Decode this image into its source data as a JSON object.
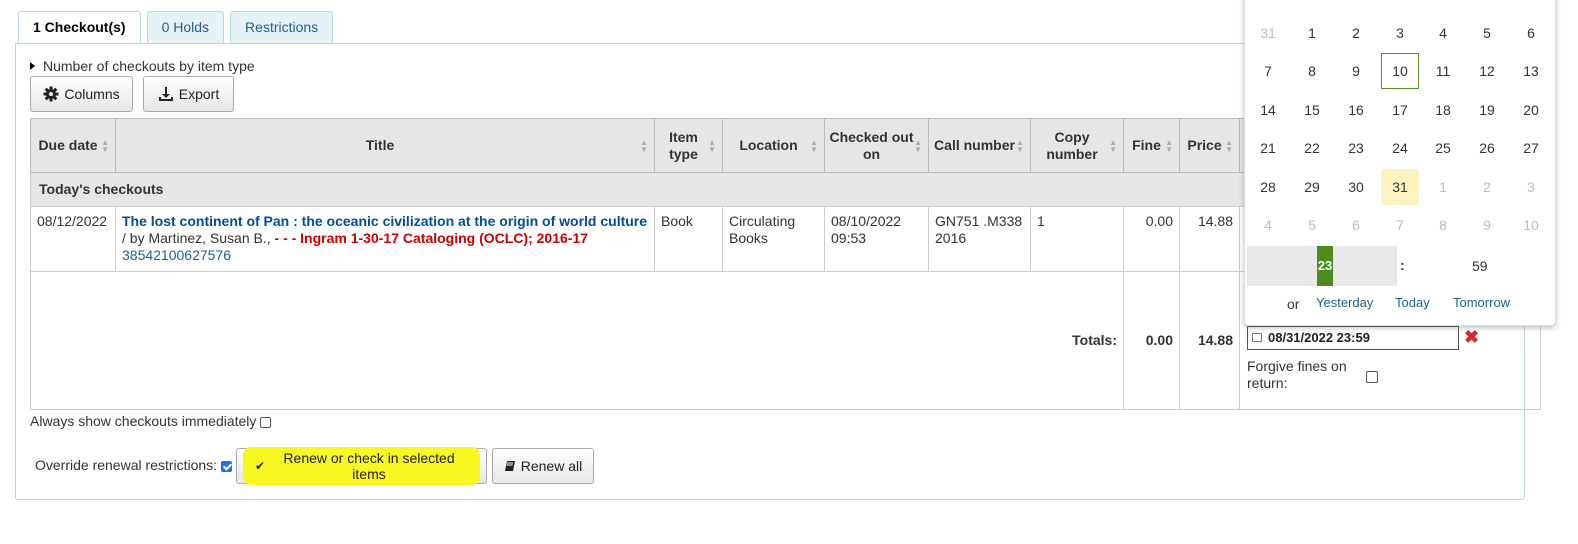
{
  "tabs": [
    {
      "label": "1 Checkout(s)"
    },
    {
      "label": "0 Holds"
    },
    {
      "label": "Restrictions"
    }
  ],
  "summary_toggle": "Number of checkouts by item type",
  "buttons": {
    "columns": "Columns",
    "export": "Export"
  },
  "table": {
    "headers": {
      "due": "Due date",
      "title": "Title",
      "itemtype": "Item type",
      "location": "Location",
      "checkedout": "Checked out on",
      "callnumber": "Call number",
      "copynumber": "Copy number",
      "fine": "Fine",
      "price": "Price"
    },
    "group_label": "Today's checkouts",
    "row": {
      "due": "08/12/2022",
      "title": "The lost continent of Pan : the oceanic civilization at the origin of world culture",
      "author": " / by Martinez, Susan B.,",
      "dashes": " - - - ",
      "cataloging": "Ingram 1-30-17 Cataloging (OCLC); 2016-17",
      "barcode": "38542100627576",
      "itemtype": "Book",
      "location": "Circulating Books",
      "checkedout": "08/10/2022 09:53",
      "callnumber": "GN751 .M338 2016",
      "copynumber": "1",
      "fine": "0.00",
      "price": "14.88"
    },
    "totals": {
      "label": "Totals:",
      "fine": "0.00",
      "price": "14.88"
    }
  },
  "always_show": "Always show checkouts immediately",
  "override": "Override renewal restrictions:",
  "renew_selected": "Renew or check in selected items",
  "renew_all": "Renew all",
  "calendar": {
    "weeks": [
      [
        "31",
        "1",
        "2",
        "3",
        "4",
        "5",
        "6"
      ],
      [
        "7",
        "8",
        "9",
        "10",
        "11",
        "12",
        "13"
      ],
      [
        "14",
        "15",
        "16",
        "17",
        "18",
        "19",
        "20"
      ],
      [
        "21",
        "22",
        "23",
        "24",
        "25",
        "26",
        "27"
      ],
      [
        "28",
        "29",
        "30",
        "31",
        "1",
        "2",
        "3"
      ],
      [
        "4",
        "5",
        "6",
        "7",
        "8",
        "9",
        "10"
      ]
    ],
    "hour": "23",
    "colon": ":",
    "minutes": "59",
    "or_label": "or",
    "yesterday": "Yesterday",
    "today": "Today",
    "tomorrow": "Tomorrow"
  },
  "due_input": "08/31/2022 23:59",
  "forgive_label": "Forgive fines on return:",
  "colors": {
    "highlight": "#f7f722",
    "link": "#004d99",
    "red": "#cc0000",
    "today_border": "#5b8a1e"
  }
}
